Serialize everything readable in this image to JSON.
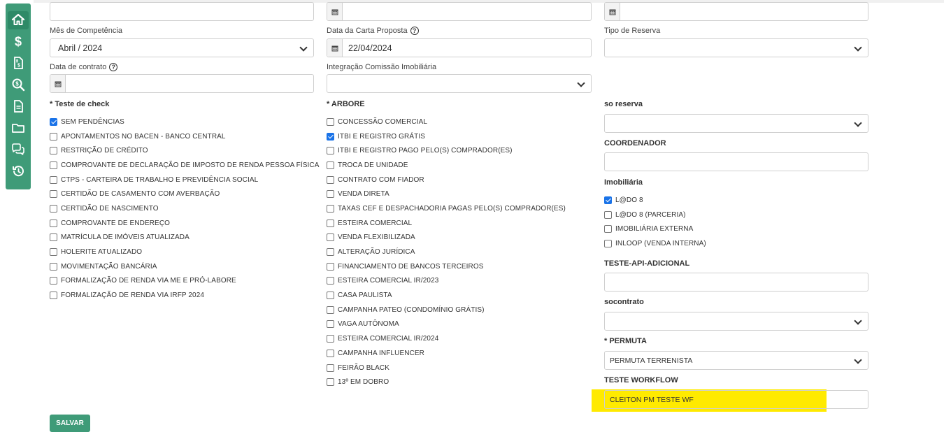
{
  "sidebar": {
    "items": [
      {
        "icon": "home-icon"
      },
      {
        "icon": "dollar-icon"
      },
      {
        "icon": "invoice-icon"
      },
      {
        "icon": "search-money-icon"
      },
      {
        "icon": "document-icon"
      },
      {
        "icon": "folder-icon"
      },
      {
        "icon": "comments-icon"
      },
      {
        "icon": "history-icon"
      }
    ]
  },
  "form": {
    "mes_competencia": {
      "label": "Mês de Competência",
      "value": "Abril / 2024"
    },
    "data_carta": {
      "label": "Data da Carta Proposta",
      "value": "22/04/2024"
    },
    "tipo_reserva": {
      "label": "Tipo de Reserva",
      "value": ""
    },
    "data_contrato": {
      "label": "Data de contrato",
      "value": ""
    },
    "integracao": {
      "label": "Integração Comissão Imobiliária",
      "value": ""
    },
    "so_reserva": {
      "label": "so reserva",
      "value": ""
    },
    "coordenador": {
      "label": "COORDENADOR",
      "value": ""
    },
    "teste_api": {
      "label": "TESTE-API-ADICIONAL",
      "value": ""
    },
    "socontrato": {
      "label": "socontrato",
      "value": ""
    },
    "permuta": {
      "label": "* PERMUTA",
      "value": "PERMUTA TERRENISTA"
    },
    "teste_workflow": {
      "label": "TESTE WORKFLOW",
      "value": "CLEITON PM TESTE WF"
    }
  },
  "teste_check": {
    "title": "* Teste de check",
    "items": [
      {
        "label": "SEM PENDÊNCIAS",
        "checked": true
      },
      {
        "label": "APONTAMENTOS NO BACEN - BANCO CENTRAL",
        "checked": false
      },
      {
        "label": "RESTRIÇÃO DE CRÉDITO",
        "checked": false
      },
      {
        "label": "COMPROVANTE DE DECLARAÇÃO DE IMPOSTO DE RENDA PESSOA FÍSICA",
        "checked": false
      },
      {
        "label": "CTPS - CARTEIRA DE TRABALHO E PREVIDÊNCIA SOCIAL",
        "checked": false
      },
      {
        "label": "CERTIDÃO DE CASAMENTO COM AVERBAÇÃO",
        "checked": false
      },
      {
        "label": "CERTIDÃO DE NASCIMENTO",
        "checked": false
      },
      {
        "label": "COMPROVANTE DE ENDEREÇO",
        "checked": false
      },
      {
        "label": "MATRÍCULA DE IMÓVEIS ATUALIZADA",
        "checked": false
      },
      {
        "label": "HOLERITE ATUALIZADO",
        "checked": false
      },
      {
        "label": "MOVIMENTAÇÃO BANCÁRIA",
        "checked": false
      },
      {
        "label": "FORMALIZAÇÃO DE RENDA VIA ME E PRÓ-LABORE",
        "checked": false
      },
      {
        "label": "FORMALIZAÇÃO DE RENDA VIA IRFP 2024",
        "checked": false
      }
    ]
  },
  "arbore": {
    "title": "* ARBORE",
    "items": [
      {
        "label": "CONCESSÃO COMERCIAL",
        "checked": false
      },
      {
        "label": "ITBI E REGISTRO GRÁTIS",
        "checked": true
      },
      {
        "label": "ITBI E REGISTRO PAGO PELO(S) COMPRADOR(ES)",
        "checked": false
      },
      {
        "label": "TROCA DE UNIDADE",
        "checked": false
      },
      {
        "label": "CONTRATO COM FIADOR",
        "checked": false
      },
      {
        "label": "VENDA DIRETA",
        "checked": false
      },
      {
        "label": "TAXAS CEF E DESPACHADORIA PAGAS PELO(S) COMPRADOR(ES)",
        "checked": false
      },
      {
        "label": "ESTEIRA COMERCIAL",
        "checked": false
      },
      {
        "label": "VENDA FLEXIBILIZADA",
        "checked": false
      },
      {
        "label": "ALTERAÇÃO JURÍDICA",
        "checked": false
      },
      {
        "label": "FINANCIAMENTO DE BANCOS TERCEIROS",
        "checked": false
      },
      {
        "label": "ESTEIRA COMERCIAL IR/2023",
        "checked": false
      },
      {
        "label": "CASA PAULISTA",
        "checked": false
      },
      {
        "label": "CAMPANHA PATEO (CONDOMÍNIO GRÁTIS)",
        "checked": false
      },
      {
        "label": "VAGA AUTÔNOMA",
        "checked": false
      },
      {
        "label": "ESTEIRA COMERCIAL IR/2024",
        "checked": false
      },
      {
        "label": "CAMPANHA INFLUENCER",
        "checked": false
      },
      {
        "label": "FEIRÃO BLACK",
        "checked": false
      },
      {
        "label": "13º EM DOBRO",
        "checked": false
      }
    ]
  },
  "imobiliaria": {
    "title": "Imobiliária",
    "items": [
      {
        "label": "L@DO 8",
        "checked": true
      },
      {
        "label": "L@DO 8 (PARCERIA)",
        "checked": false
      },
      {
        "label": "IMOBILIÁRIA EXTERNA",
        "checked": false
      },
      {
        "label": "INLOOP (VENDA INTERNA)",
        "checked": false
      }
    ]
  },
  "actions": {
    "save_label": "SALVAR"
  },
  "colors": {
    "brand": "#3f9b78",
    "highlight": "#ffea00",
    "checkbox": "#1a73e8"
  }
}
